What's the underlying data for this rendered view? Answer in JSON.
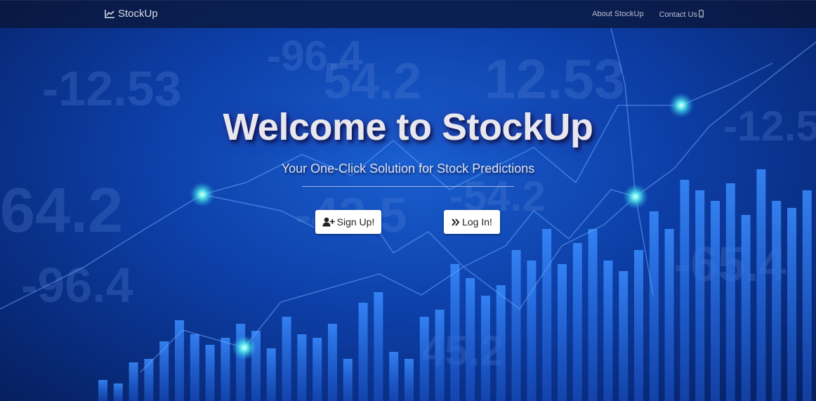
{
  "nav": {
    "brand": "StockUp",
    "links": [
      {
        "label": "About StockUp"
      },
      {
        "label": "Contact Us"
      }
    ]
  },
  "hero": {
    "title": "Welcome to StockUp",
    "subtitle": "Your One-Click Solution for Stock Predictions",
    "signup_label": "Sign Up!",
    "login_label": "Log In!"
  },
  "background_numbers": [
    "-12.53",
    "54.2",
    "12.53",
    "-96.4",
    "64.2",
    "-42.5",
    "-54.2",
    "-96.4",
    "-12.5",
    "45.2",
    "-65.4"
  ],
  "icons": {
    "brand": "line-chart-icon",
    "contact": "mobile-phone-icon",
    "signup": "user-plus-icon",
    "login": "double-chevron-right-icon"
  },
  "colors": {
    "background": "#0d3fa8",
    "navbar": "#0a1432",
    "title": "#e9e7ee",
    "button": "#ffffff",
    "glow": "#5ff5f0"
  }
}
